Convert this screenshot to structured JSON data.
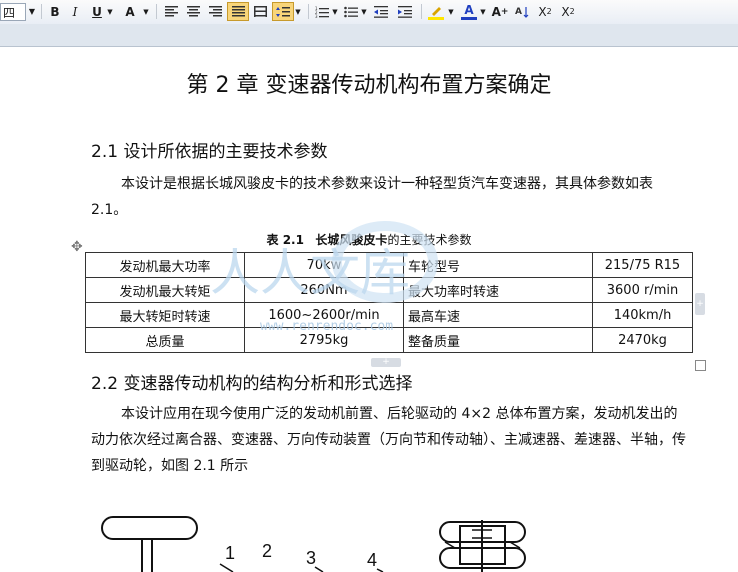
{
  "toolbar": {
    "font_size_value": "四",
    "bold": "B",
    "italic": "I",
    "underline": "U",
    "char_shade": "A",
    "font_color": "A",
    "grow_font": "A",
    "superscript": "X",
    "superscript_mark": "2",
    "subscript": "X",
    "subscript_mark": "2",
    "highlight_color": "#ffe600",
    "font_color_value": "#1f3fbf"
  },
  "document": {
    "chapter_title": "第 2 章  变速器传动机构布置方案确定",
    "section1_title": "2.1 设计所依据的主要技术参数",
    "section1_para": "本设计是根据长城风骏皮卡的技术参数来设计一种轻型货汽车变速器，其具体参数如表 2.1。",
    "table_caption_prefix": "表 2.1",
    "table_caption_bold": "长城风骏皮卡",
    "table_caption_suffix": "的主要技术参数",
    "table_rows": [
      [
        "发动机最大功率",
        "70kw",
        "车轮型号",
        "215/75 R15"
      ],
      [
        "发动机最大转矩",
        "260Nm",
        "最大功率时转速",
        "3600 r/min"
      ],
      [
        "最大转矩时转速",
        "1600~2600r/min",
        "最高车速",
        "140km/h"
      ],
      [
        "总质量",
        "2795kg",
        "整备质量",
        "2470kg"
      ]
    ],
    "section2_title": "2.2  变速器传动机构的结构分析和形式选择",
    "section2_para": "本设计应用在现今使用广泛的发动机前置、后轮驱动的 4×2 总体布置方案，发动机发出的动力依次经过离合器、变速器、万向传动装置（万向节和传动轴）、主减速器、差速器、半轴，传到驱动轮，如图 2.1 所示",
    "figure_labels": [
      "1",
      "2",
      "3",
      "4"
    ]
  },
  "watermark": {
    "text": "人人文库",
    "url_text": "www.renrendoc.com"
  }
}
